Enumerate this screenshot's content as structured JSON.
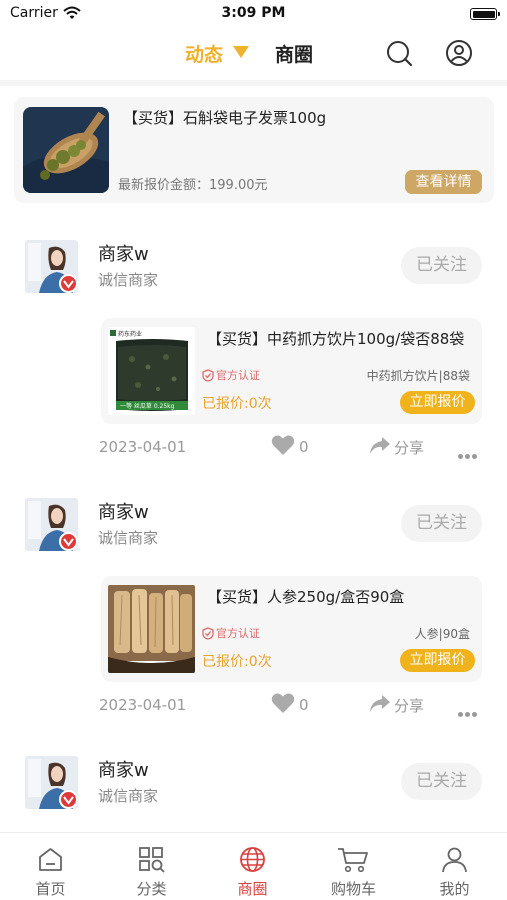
{
  "status_bar": {
    "carrier": "Carrier",
    "time": "3:09 PM"
  },
  "top_nav": {
    "tabs": [
      {
        "label": "动态",
        "active": true
      },
      {
        "label": "商圈",
        "active": false
      }
    ],
    "icons": [
      "search-icon",
      "user-icon"
    ],
    "accent_color": "#f0b12c"
  },
  "featured": {
    "title": "【买货】石斛袋电子发票100g",
    "price_text": "最新报价金额：199.00元",
    "detail_button": "查看详情"
  },
  "posts": [
    {
      "merchant": "商家w",
      "subtitle": "诚信商家",
      "follow_label": "已关注",
      "item": {
        "title": "【买货】中药抓方饮片100g/袋否88袋",
        "official": "官方认证",
        "tags": "中药抓方饮片|88袋",
        "quoted": "已报价:0次",
        "quote_button": "立即报价",
        "image_caption": "一等 丝瓜草 0.25kg",
        "image_brand": "药东药业"
      },
      "date": "2023-04-01",
      "likes": "0",
      "share": "分享"
    },
    {
      "merchant": "商家w",
      "subtitle": "诚信商家",
      "follow_label": "已关注",
      "item": {
        "title": "【买货】人参250g/盒否90盒",
        "official": "官方认证",
        "tags": "人参|90盒",
        "quoted": "已报价:0次",
        "quote_button": "立即报价"
      },
      "date": "2023-04-01",
      "likes": "0",
      "share": "分享"
    },
    {
      "merchant": "商家w",
      "subtitle": "诚信商家",
      "follow_label": "已关注"
    }
  ],
  "tabbar": {
    "items": [
      {
        "label": "首页",
        "icon": "home-icon"
      },
      {
        "label": "分类",
        "icon": "category-icon"
      },
      {
        "label": "商圈",
        "icon": "globe-icon",
        "active": true
      },
      {
        "label": "购物车",
        "icon": "cart-icon"
      },
      {
        "label": "我的",
        "icon": "profile-icon"
      }
    ],
    "active_color": "#d8413e"
  }
}
